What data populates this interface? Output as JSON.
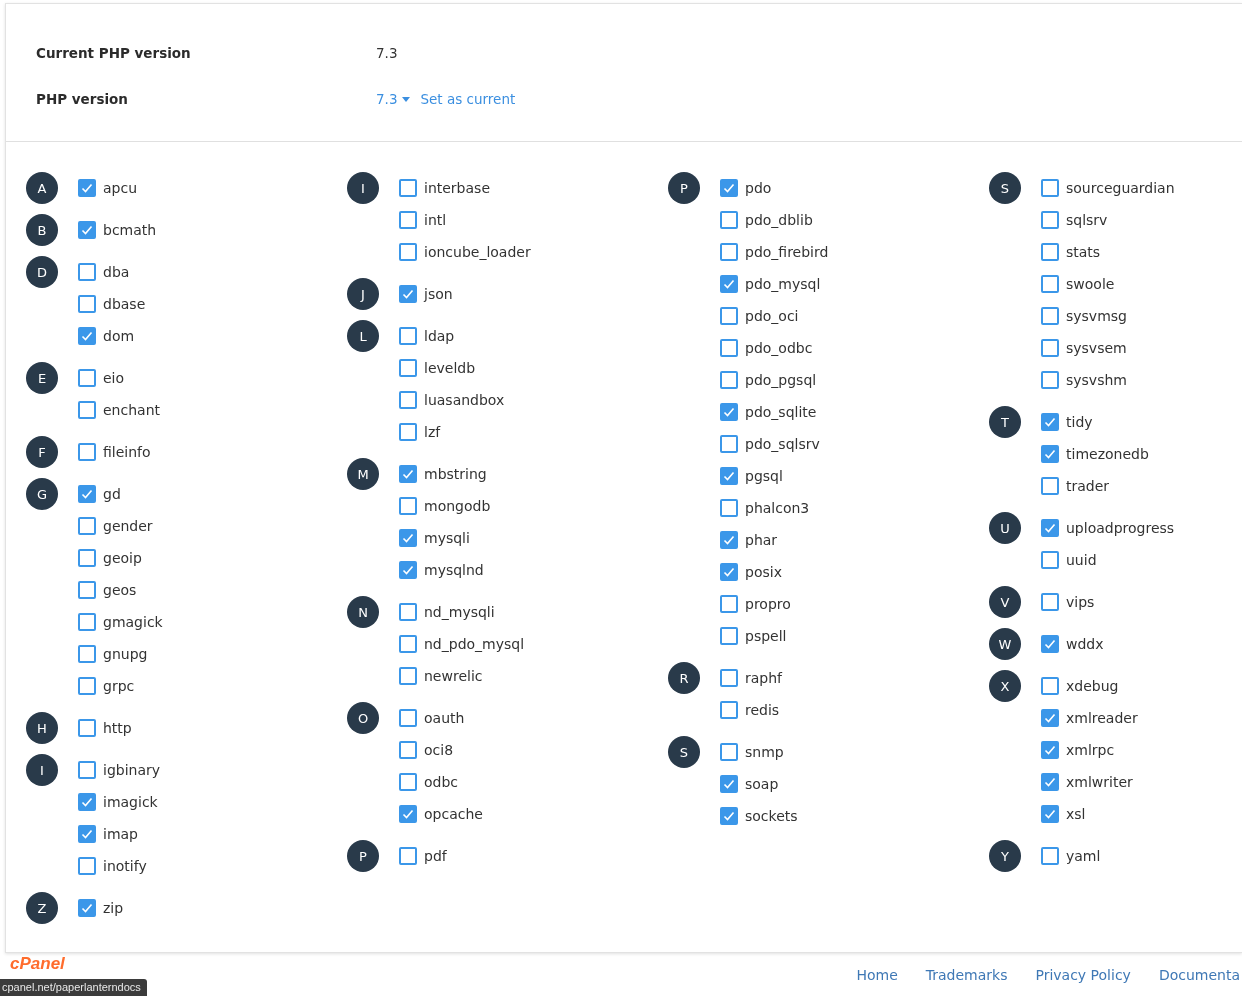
{
  "settings": [
    {
      "label": "Current PHP version",
      "value": "7.3"
    },
    {
      "label": "PHP version",
      "version": "7.3",
      "action": "Set as current"
    }
  ],
  "columns": [
    [
      {
        "letter": "A",
        "items": [
          {
            "name": "apcu",
            "checked": true
          }
        ]
      },
      {
        "letter": "B",
        "items": [
          {
            "name": "bcmath",
            "checked": true
          }
        ]
      },
      {
        "letter": "D",
        "items": [
          {
            "name": "dba",
            "checked": false
          },
          {
            "name": "dbase",
            "checked": false
          },
          {
            "name": "dom",
            "checked": true
          }
        ]
      },
      {
        "letter": "E",
        "items": [
          {
            "name": "eio",
            "checked": false
          },
          {
            "name": "enchant",
            "checked": false
          }
        ]
      },
      {
        "letter": "F",
        "items": [
          {
            "name": "fileinfo",
            "checked": false
          }
        ]
      },
      {
        "letter": "G",
        "items": [
          {
            "name": "gd",
            "checked": true
          },
          {
            "name": "gender",
            "checked": false
          },
          {
            "name": "geoip",
            "checked": false
          },
          {
            "name": "geos",
            "checked": false
          },
          {
            "name": "gmagick",
            "checked": false
          },
          {
            "name": "gnupg",
            "checked": false
          },
          {
            "name": "grpc",
            "checked": false
          }
        ]
      },
      {
        "letter": "H",
        "items": [
          {
            "name": "http",
            "checked": false
          }
        ]
      },
      {
        "letter": "I",
        "items": [
          {
            "name": "igbinary",
            "checked": false
          },
          {
            "name": "imagick",
            "checked": true
          },
          {
            "name": "imap",
            "checked": true
          },
          {
            "name": "inotify",
            "checked": false
          }
        ]
      },
      {
        "letter": "Z",
        "items": [
          {
            "name": "zip",
            "checked": true
          }
        ]
      }
    ],
    [
      {
        "letter": "I",
        "items": [
          {
            "name": "interbase",
            "checked": false
          },
          {
            "name": "intl",
            "checked": false
          },
          {
            "name": "ioncube_loader",
            "checked": false
          }
        ]
      },
      {
        "letter": "J",
        "items": [
          {
            "name": "json",
            "checked": true
          }
        ]
      },
      {
        "letter": "L",
        "items": [
          {
            "name": "ldap",
            "checked": false
          },
          {
            "name": "leveldb",
            "checked": false
          },
          {
            "name": "luasandbox",
            "checked": false
          },
          {
            "name": "lzf",
            "checked": false
          }
        ]
      },
      {
        "letter": "M",
        "items": [
          {
            "name": "mbstring",
            "checked": true
          },
          {
            "name": "mongodb",
            "checked": false
          },
          {
            "name": "mysqli",
            "checked": true
          },
          {
            "name": "mysqlnd",
            "checked": true
          }
        ]
      },
      {
        "letter": "N",
        "items": [
          {
            "name": "nd_mysqli",
            "checked": false
          },
          {
            "name": "nd_pdo_mysql",
            "checked": false
          },
          {
            "name": "newrelic",
            "checked": false
          }
        ]
      },
      {
        "letter": "O",
        "items": [
          {
            "name": "oauth",
            "checked": false
          },
          {
            "name": "oci8",
            "checked": false
          },
          {
            "name": "odbc",
            "checked": false
          },
          {
            "name": "opcache",
            "checked": true
          }
        ]
      },
      {
        "letter": "P",
        "items": [
          {
            "name": "pdf",
            "checked": false
          }
        ]
      }
    ],
    [
      {
        "letter": "P",
        "items": [
          {
            "name": "pdo",
            "checked": true
          },
          {
            "name": "pdo_dblib",
            "checked": false
          },
          {
            "name": "pdo_firebird",
            "checked": false
          },
          {
            "name": "pdo_mysql",
            "checked": true
          },
          {
            "name": "pdo_oci",
            "checked": false
          },
          {
            "name": "pdo_odbc",
            "checked": false
          },
          {
            "name": "pdo_pgsql",
            "checked": false
          },
          {
            "name": "pdo_sqlite",
            "checked": true
          },
          {
            "name": "pdo_sqlsrv",
            "checked": false
          },
          {
            "name": "pgsql",
            "checked": true
          },
          {
            "name": "phalcon3",
            "checked": false
          },
          {
            "name": "phar",
            "checked": true
          },
          {
            "name": "posix",
            "checked": true
          },
          {
            "name": "propro",
            "checked": false
          },
          {
            "name": "pspell",
            "checked": false
          }
        ]
      },
      {
        "letter": "R",
        "items": [
          {
            "name": "raphf",
            "checked": false
          },
          {
            "name": "redis",
            "checked": false
          }
        ]
      },
      {
        "letter": "S",
        "items": [
          {
            "name": "snmp",
            "checked": false
          },
          {
            "name": "soap",
            "checked": true
          },
          {
            "name": "sockets",
            "checked": true
          }
        ]
      }
    ],
    [
      {
        "letter": "S",
        "items": [
          {
            "name": "sourceguardian",
            "checked": false
          },
          {
            "name": "sqlsrv",
            "checked": false
          },
          {
            "name": "stats",
            "checked": false
          },
          {
            "name": "swoole",
            "checked": false
          },
          {
            "name": "sysvmsg",
            "checked": false
          },
          {
            "name": "sysvsem",
            "checked": false
          },
          {
            "name": "sysvshm",
            "checked": false
          }
        ]
      },
      {
        "letter": "T",
        "items": [
          {
            "name": "tidy",
            "checked": true
          },
          {
            "name": "timezonedb",
            "checked": true
          },
          {
            "name": "trader",
            "checked": false
          }
        ]
      },
      {
        "letter": "U",
        "items": [
          {
            "name": "uploadprogress",
            "checked": true
          },
          {
            "name": "uuid",
            "checked": false
          }
        ]
      },
      {
        "letter": "V",
        "items": [
          {
            "name": "vips",
            "checked": false
          }
        ]
      },
      {
        "letter": "W",
        "items": [
          {
            "name": "wddx",
            "checked": true
          }
        ]
      },
      {
        "letter": "X",
        "items": [
          {
            "name": "xdebug",
            "checked": false
          },
          {
            "name": "xmlreader",
            "checked": true
          },
          {
            "name": "xmlrpc",
            "checked": true
          },
          {
            "name": "xmlwriter",
            "checked": true
          },
          {
            "name": "xsl",
            "checked": true
          }
        ]
      },
      {
        "letter": "Y",
        "items": [
          {
            "name": "yaml",
            "checked": false
          }
        ]
      }
    ]
  ],
  "footer": {
    "logo": "cPanel",
    "links": [
      "Home",
      "Trademarks",
      "Privacy Policy",
      "Documenta"
    ]
  },
  "status_tooltip": "cpanel.net/paperlanterndocs"
}
